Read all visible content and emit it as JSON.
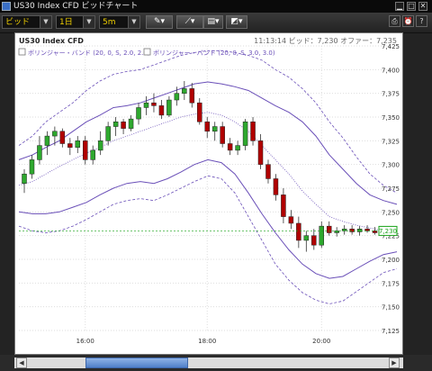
{
  "window": {
    "title": "US30 Index CFD ビッドチャート"
  },
  "toolbar": {
    "price_type": "ビッド",
    "period": "1日",
    "interval": "5m"
  },
  "chart": {
    "symbol": "US30 Index CFD",
    "status": "11:13:14  ビッド：7,230  オファー：7,235",
    "indicator1": "ボリンジャー・バンド (20, 0, S, 2.0, 2.0)",
    "indicator2": "ボリンジャー・バンド (20, 0, S, 3.0, 3.0)",
    "current_price_label": "7,230",
    "colors": {
      "up": "#2ea82e",
      "down": "#b00000",
      "band": "#6a4fb8",
      "current": "#1aa31a"
    }
  },
  "chart_data": {
    "type": "candlestick",
    "x_ticks": [
      "16:00",
      "18:00",
      "20:00"
    ],
    "y_ticks": [
      "7,425",
      "7,400",
      "7,375",
      "7,350",
      "7,325",
      "7,300",
      "7,275",
      "7,250",
      "7,225",
      "7,200",
      "7,175",
      "7,150",
      "7,125"
    ],
    "ylim": [
      7125,
      7425
    ],
    "grid": true,
    "current_price": 7230,
    "candles": [
      [
        7280,
        7295,
        7270,
        7290
      ],
      [
        7290,
        7310,
        7285,
        7305
      ],
      [
        7305,
        7330,
        7300,
        7320
      ],
      [
        7320,
        7335,
        7310,
        7330
      ],
      [
        7330,
        7340,
        7320,
        7335
      ],
      [
        7335,
        7338,
        7318,
        7322
      ],
      [
        7322,
        7328,
        7310,
        7318
      ],
      [
        7318,
        7330,
        7312,
        7325
      ],
      [
        7325,
        7330,
        7300,
        7305
      ],
      [
        7305,
        7320,
        7300,
        7315
      ],
      [
        7315,
        7335,
        7310,
        7325
      ],
      [
        7325,
        7345,
        7320,
        7340
      ],
      [
        7340,
        7350,
        7330,
        7345
      ],
      [
        7345,
        7348,
        7332,
        7338
      ],
      [
        7338,
        7352,
        7335,
        7348
      ],
      [
        7348,
        7365,
        7342,
        7360
      ],
      [
        7360,
        7372,
        7352,
        7365
      ],
      [
        7365,
        7375,
        7355,
        7362
      ],
      [
        7362,
        7368,
        7348,
        7352
      ],
      [
        7352,
        7372,
        7350,
        7368
      ],
      [
        7368,
        7382,
        7362,
        7375
      ],
      [
        7375,
        7388,
        7368,
        7380
      ],
      [
        7380,
        7386,
        7360,
        7365
      ],
      [
        7365,
        7370,
        7342,
        7345
      ],
      [
        7345,
        7350,
        7328,
        7335
      ],
      [
        7335,
        7345,
        7325,
        7340
      ],
      [
        7340,
        7345,
        7318,
        7322
      ],
      [
        7322,
        7328,
        7310,
        7315
      ],
      [
        7315,
        7325,
        7310,
        7320
      ],
      [
        7320,
        7348,
        7315,
        7345
      ],
      [
        7345,
        7350,
        7320,
        7325
      ],
      [
        7325,
        7332,
        7295,
        7300
      ],
      [
        7300,
        7305,
        7280,
        7285
      ],
      [
        7285,
        7290,
        7262,
        7268
      ],
      [
        7268,
        7275,
        7238,
        7245
      ],
      [
        7245,
        7252,
        7232,
        7238
      ],
      [
        7238,
        7245,
        7212,
        7220
      ],
      [
        7220,
        7230,
        7208,
        7225
      ],
      [
        7225,
        7232,
        7210,
        7215
      ],
      [
        7215,
        7240,
        7212,
        7235
      ],
      [
        7235,
        7240,
        7225,
        7228
      ],
      [
        7228,
        7234,
        7224,
        7230
      ],
      [
        7230,
        7236,
        7226,
        7232
      ],
      [
        7232,
        7236,
        7226,
        7229
      ],
      [
        7229,
        7235,
        7225,
        7232
      ],
      [
        7232,
        7236,
        7228,
        7230
      ],
      [
        7230,
        7234,
        7226,
        7228
      ],
      [
        7228,
        7232,
        7225,
        7230
      ]
    ],
    "band_upper_2": [
      7305,
      7310,
      7318,
      7325,
      7335,
      7345,
      7352,
      7360,
      7362,
      7365,
      7370,
      7375,
      7380,
      7385,
      7387,
      7385,
      7382,
      7378,
      7370,
      7362,
      7355,
      7345,
      7330,
      7310,
      7295,
      7280,
      7268,
      7262,
      7258
    ],
    "band_lower_2": [
      7250,
      7248,
      7248,
      7250,
      7255,
      7260,
      7268,
      7275,
      7280,
      7282,
      7280,
      7285,
      7292,
      7300,
      7305,
      7302,
      7290,
      7270,
      7248,
      7228,
      7210,
      7195,
      7185,
      7180,
      7182,
      7190,
      7198,
      7205,
      7208
    ],
    "band_upper_3": [
      7320,
      7330,
      7345,
      7355,
      7365,
      7378,
      7388,
      7395,
      7398,
      7400,
      7405,
      7410,
      7415,
      7418,
      7420,
      7420,
      7418,
      7415,
      7410,
      7400,
      7392,
      7380,
      7365,
      7345,
      7328,
      7308,
      7290,
      7278,
      7270
    ],
    "band_lower_3": [
      7235,
      7230,
      7228,
      7230,
      7235,
      7242,
      7250,
      7258,
      7262,
      7264,
      7262,
      7268,
      7275,
      7282,
      7288,
      7285,
      7270,
      7245,
      7220,
      7195,
      7178,
      7165,
      7157,
      7153,
      7156,
      7166,
      7176,
      7186,
      7190
    ],
    "middle": [
      7278,
      7282,
      7290,
      7298,
      7305,
      7312,
      7318,
      7325,
      7330,
      7335,
      7340,
      7345,
      7350,
      7353,
      7355,
      7352,
      7345,
      7335,
      7320,
      7305,
      7290,
      7272,
      7258,
      7245,
      7240,
      7236,
      7233,
      7230,
      7229
    ]
  }
}
